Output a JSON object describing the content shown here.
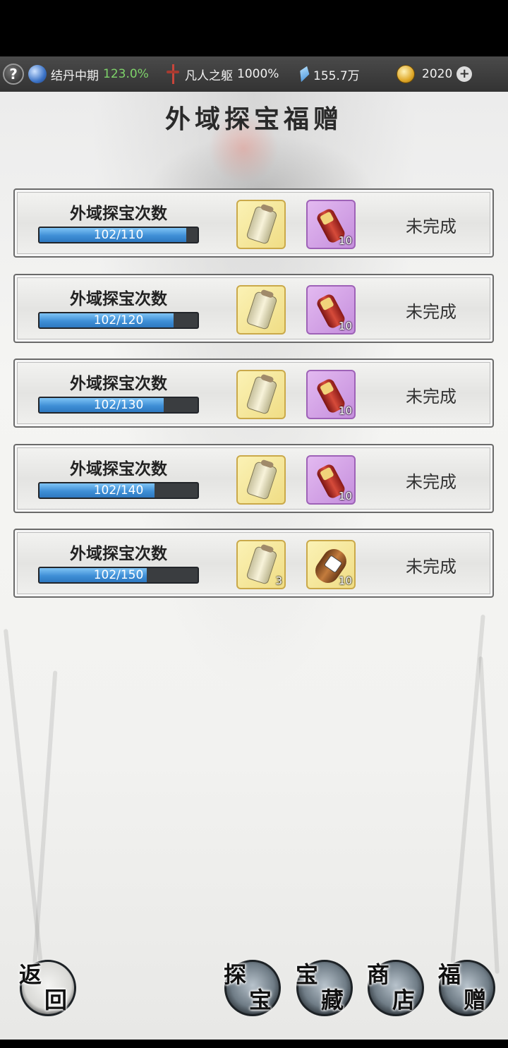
{
  "statusbar": {
    "help_label": "?",
    "realm_name": "结丹中期",
    "realm_percent": "123.0%",
    "body_name": "凡人之躯",
    "body_percent": "1000%",
    "crystal_amount": "155.7万",
    "coin_amount": "2020",
    "plus_label": "+"
  },
  "title": "外域探宝福赠",
  "tasks": [
    {
      "name": "外域探宝次数",
      "progress_text": "102/110",
      "progress": 0.927,
      "reward1": "scroll",
      "reward1_count": "",
      "reward2": "pouch",
      "reward2_count": "10",
      "status": "未完成"
    },
    {
      "name": "外域探宝次数",
      "progress_text": "102/120",
      "progress": 0.85,
      "reward1": "scroll",
      "reward1_count": "",
      "reward2": "pouch",
      "reward2_count": "10",
      "status": "未完成"
    },
    {
      "name": "外域探宝次数",
      "progress_text": "102/130",
      "progress": 0.785,
      "reward1": "scroll",
      "reward1_count": "",
      "reward2": "pouch",
      "reward2_count": "10",
      "status": "未完成"
    },
    {
      "name": "外域探宝次数",
      "progress_text": "102/140",
      "progress": 0.729,
      "reward1": "scroll",
      "reward1_count": "",
      "reward2": "pouch",
      "reward2_count": "10",
      "status": "未完成"
    },
    {
      "name": "外域探宝次数",
      "progress_text": "102/150",
      "progress": 0.68,
      "reward1": "scroll",
      "reward1_count": "3",
      "reward2": "gourd",
      "reward2_count": "10",
      "status": "未完成"
    }
  ],
  "buttons": {
    "back": [
      "返",
      "回"
    ],
    "explore": [
      "探",
      "宝"
    ],
    "treasure": [
      "宝",
      "藏"
    ],
    "shop": [
      "商",
      "店"
    ],
    "gift": [
      "福",
      "赠"
    ]
  },
  "colors": {
    "progress_fill": "#3f8fd6",
    "realm_percent": "#7ed36a"
  }
}
